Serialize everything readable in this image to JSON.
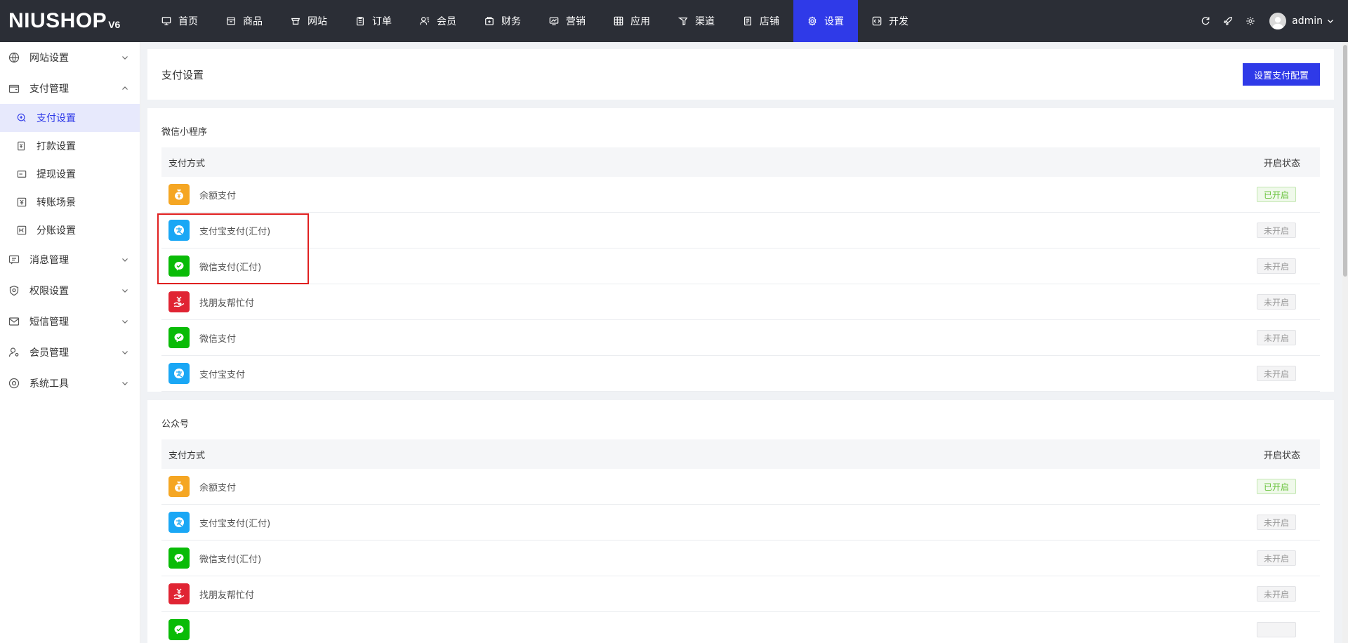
{
  "brand": {
    "logo": "NIUSHOP",
    "version": "V6"
  },
  "nav": [
    {
      "label": "首页",
      "icon": "monitor-icon"
    },
    {
      "label": "商品",
      "icon": "box-icon"
    },
    {
      "label": "网站",
      "icon": "globe-icon"
    },
    {
      "label": "订单",
      "icon": "clipboard-icon"
    },
    {
      "label": "会员",
      "icon": "user-icon"
    },
    {
      "label": "财务",
      "icon": "wallet-icon"
    },
    {
      "label": "营销",
      "icon": "chart-icon"
    },
    {
      "label": "应用",
      "icon": "grid-icon"
    },
    {
      "label": "渠道",
      "icon": "channel-icon"
    },
    {
      "label": "店铺",
      "icon": "store-icon"
    },
    {
      "label": "设置",
      "icon": "gear-icon",
      "active": true
    },
    {
      "label": "开发",
      "icon": "code-icon"
    }
  ],
  "topright": {
    "username": "admin"
  },
  "sidebar": {
    "groups": [
      {
        "label": "网站设置",
        "icon": "globe-icon",
        "expanded": false
      },
      {
        "label": "支付管理",
        "icon": "wallet-icon",
        "expanded": true,
        "items": [
          {
            "label": "支付设置",
            "active": true
          },
          {
            "label": "打款设置"
          },
          {
            "label": "提现设置"
          },
          {
            "label": "转账场景"
          },
          {
            "label": "分账设置"
          }
        ]
      },
      {
        "label": "消息管理",
        "icon": "message-icon",
        "expanded": false
      },
      {
        "label": "权限设置",
        "icon": "shield-icon",
        "expanded": false
      },
      {
        "label": "短信管理",
        "icon": "mail-icon",
        "expanded": false
      },
      {
        "label": "会员管理",
        "icon": "user-gear-icon",
        "expanded": false
      },
      {
        "label": "系统工具",
        "icon": "tool-icon",
        "expanded": false
      }
    ]
  },
  "page": {
    "title": "支付设置",
    "config_button": "设置支付配置"
  },
  "sections": [
    {
      "title": "微信小程序",
      "col_method": "支付方式",
      "col_status": "开启状态",
      "rows": [
        {
          "name": "余额支付",
          "icon": "balance",
          "status": "已开启",
          "enabled": true
        },
        {
          "name": "支付宝支付(汇付)",
          "icon": "alipay",
          "status": "未开启",
          "enabled": false
        },
        {
          "name": "微信支付(汇付)",
          "icon": "wechat",
          "status": "未开启",
          "enabled": false
        },
        {
          "name": "找朋友帮忙付",
          "icon": "friendpay",
          "status": "未开启",
          "enabled": false
        },
        {
          "name": "微信支付",
          "icon": "wechat",
          "status": "未开启",
          "enabled": false
        },
        {
          "name": "支付宝支付",
          "icon": "alipay",
          "status": "未开启",
          "enabled": false
        }
      ]
    },
    {
      "title": "公众号",
      "col_method": "支付方式",
      "col_status": "开启状态",
      "rows": [
        {
          "name": "余额支付",
          "icon": "balance",
          "status": "已开启",
          "enabled": true
        },
        {
          "name": "支付宝支付(汇付)",
          "icon": "alipay",
          "status": "未开启",
          "enabled": false
        },
        {
          "name": "微信支付(汇付)",
          "icon": "wechat",
          "status": "未开启",
          "enabled": false
        },
        {
          "name": "找朋友帮忙付",
          "icon": "friendpay",
          "status": "未开启",
          "enabled": false
        },
        {
          "name": "",
          "icon": "wechat",
          "status": "",
          "enabled": false
        }
      ]
    }
  ],
  "colors": {
    "topbar": "#2b2e36",
    "accent": "#2f3ae8",
    "balance": "#f5a623",
    "alipay": "#1aa7f5",
    "wechat": "#09bb07",
    "friendpay": "#e02433",
    "highlight": "#e02020"
  }
}
